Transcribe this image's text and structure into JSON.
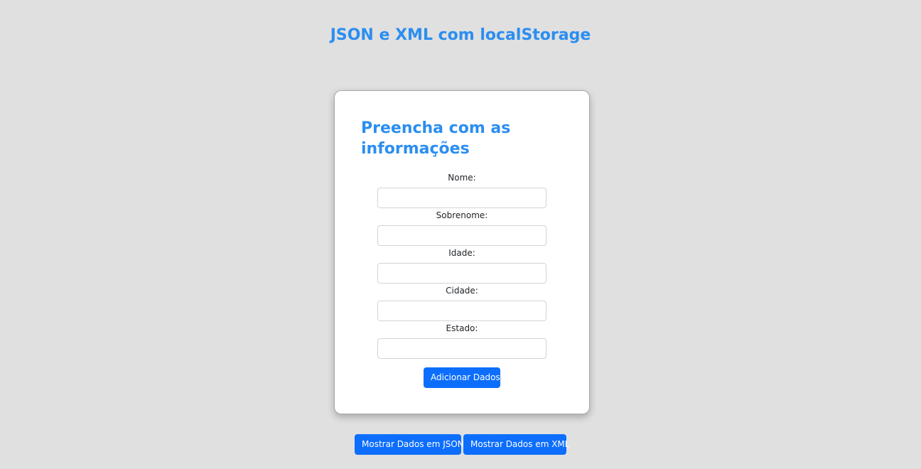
{
  "page": {
    "title": "JSON e XML com localStorage"
  },
  "form": {
    "heading": "Preencha com as informações",
    "fields": [
      {
        "label": "Nome:",
        "value": "",
        "placeholder": ""
      },
      {
        "label": "Sobrenome:",
        "value": "",
        "placeholder": ""
      },
      {
        "label": "Idade:",
        "value": "",
        "placeholder": ""
      },
      {
        "label": "Cidade:",
        "value": "",
        "placeholder": ""
      },
      {
        "label": "Estado:",
        "value": "",
        "placeholder": ""
      }
    ],
    "submit_label": "Adicionar Dados"
  },
  "actions": {
    "show_json_label": "Mostrar Dados em JSON",
    "show_xml_label": "Mostrar Dados em XML"
  },
  "colors": {
    "background": "#e0e0e0",
    "title": "#2b8ef0",
    "primary_button": "#0d6efd",
    "card": "#ffffff"
  }
}
